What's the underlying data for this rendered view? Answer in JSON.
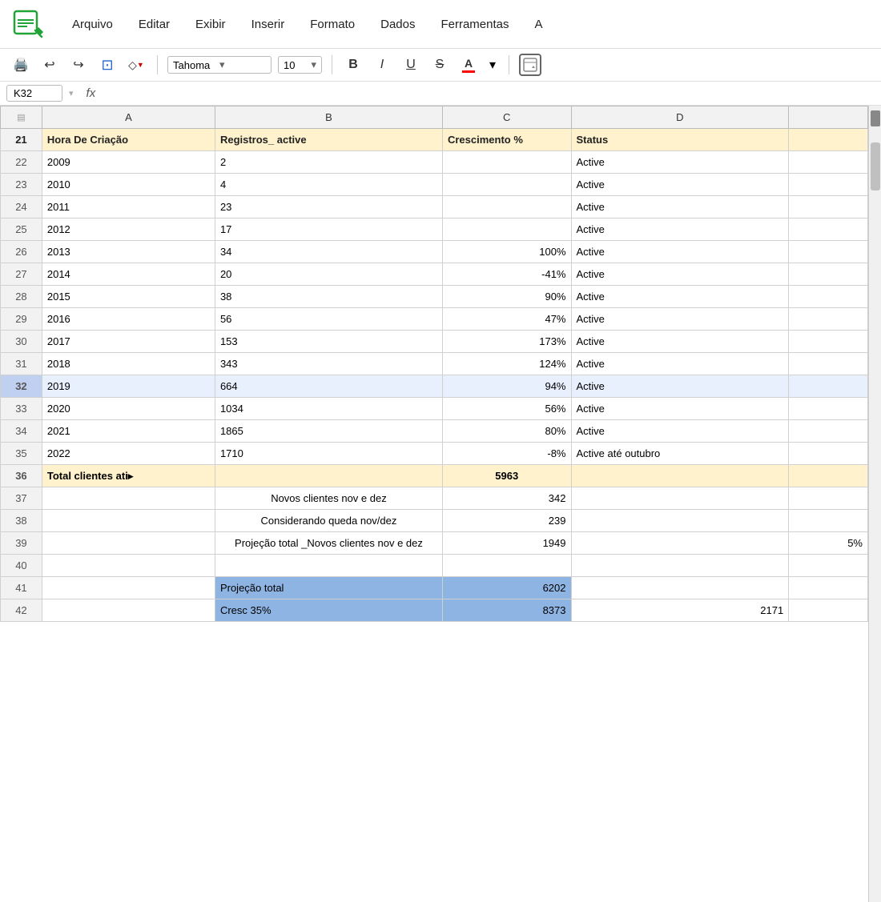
{
  "app": {
    "title": "LibreOffice Calc"
  },
  "menu": {
    "items": [
      "Arquivo",
      "Editar",
      "Exibir",
      "Inserir",
      "Formato",
      "Dados",
      "Ferramentas",
      "A"
    ]
  },
  "toolbar": {
    "font": "Tahoma",
    "font_size": "10",
    "bold": "B",
    "italic": "I",
    "underline": "U",
    "strikethrough": "S",
    "font_color": "A"
  },
  "formula_bar": {
    "cell_ref": "K32",
    "fx_label": "fx",
    "formula": ""
  },
  "columns": {
    "header_row": "21",
    "labels": [
      "",
      "A",
      "B",
      "C",
      "D",
      ""
    ],
    "col_a_header": "Hora De Criação",
    "col_b_header": "Registros_ active",
    "col_c_header": "Crescimento %",
    "col_d_header": "Status"
  },
  "rows": [
    {
      "row": "21",
      "a": "Hora De Criação",
      "b": "Registros_ active",
      "c": "Crescimento %",
      "d": "Status",
      "e": "",
      "type": "header"
    },
    {
      "row": "22",
      "a": "2009",
      "b": "2",
      "c": "",
      "d": "Active",
      "e": "",
      "type": "data"
    },
    {
      "row": "23",
      "a": "2010",
      "b": "4",
      "c": "",
      "d": "Active",
      "e": "",
      "type": "data"
    },
    {
      "row": "24",
      "a": "2011",
      "b": "23",
      "c": "",
      "d": "Active",
      "e": "",
      "type": "data"
    },
    {
      "row": "25",
      "a": "2012",
      "b": "17",
      "c": "",
      "d": "Active",
      "e": "",
      "type": "data"
    },
    {
      "row": "26",
      "a": "2013",
      "b": "34",
      "c": "100%",
      "d": "Active",
      "e": "",
      "type": "data"
    },
    {
      "row": "27",
      "a": "2014",
      "b": "20",
      "c": "-41%",
      "d": "Active",
      "e": "",
      "type": "data"
    },
    {
      "row": "28",
      "a": "2015",
      "b": "38",
      "c": "90%",
      "d": "Active",
      "e": "",
      "type": "data"
    },
    {
      "row": "29",
      "a": "2016",
      "b": "56",
      "c": "47%",
      "d": "Active",
      "e": "",
      "type": "data"
    },
    {
      "row": "30",
      "a": "2017",
      "b": "153",
      "c": "173%",
      "d": "Active",
      "e": "",
      "type": "data"
    },
    {
      "row": "31",
      "a": "2018",
      "b": "343",
      "c": "124%",
      "d": "Active",
      "e": "",
      "type": "data"
    },
    {
      "row": "32",
      "a": "2019",
      "b": "664",
      "c": "94%",
      "d": "Active",
      "e": "",
      "type": "active"
    },
    {
      "row": "33",
      "a": "2020",
      "b": "1034",
      "c": "56%",
      "d": "Active",
      "e": "",
      "type": "data"
    },
    {
      "row": "34",
      "a": "2021",
      "b": "1865",
      "c": "80%",
      "d": "Active",
      "e": "",
      "type": "data"
    },
    {
      "row": "35",
      "a": "2022",
      "b": "1710",
      "c": "-8%",
      "d": "Active até outubro",
      "e": "",
      "type": "data"
    },
    {
      "row": "36",
      "a": "Total clientes ati▸",
      "b": "",
      "c": "5963",
      "d": "",
      "e": "",
      "type": "total"
    },
    {
      "row": "37",
      "a": "",
      "b": "Novos clientes nov e dez",
      "c": "342",
      "d": "",
      "e": "",
      "type": "data"
    },
    {
      "row": "38",
      "a": "",
      "b": "Considerando queda nov/dez",
      "c": "239",
      "d": "",
      "e": "",
      "type": "data"
    },
    {
      "row": "39",
      "a": "",
      "b": "Projeção total _Novos clientes nov e dez",
      "c": "1949",
      "d": "",
      "e": "5%",
      "type": "data"
    },
    {
      "row": "40",
      "a": "",
      "b": "",
      "c": "",
      "d": "",
      "e": "",
      "type": "data"
    },
    {
      "row": "41",
      "a": "",
      "b": "Projeção total",
      "c": "6202",
      "d": "",
      "e": "",
      "type": "blue"
    },
    {
      "row": "42",
      "a": "",
      "b": "Cresc 35%",
      "c": "8373",
      "d": "2171",
      "e": "",
      "type": "blue"
    }
  ]
}
